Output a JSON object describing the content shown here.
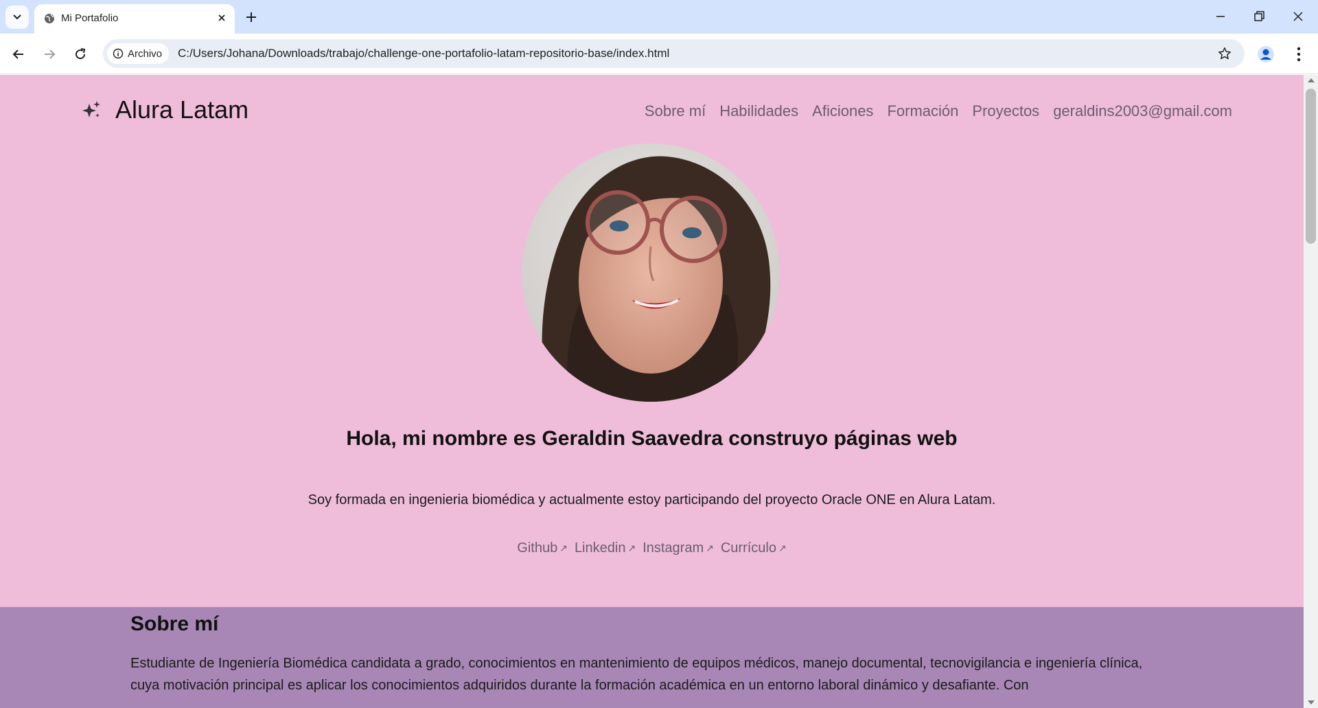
{
  "browser": {
    "tab_title": "Mi Portafolio",
    "site_chip": "Archivo",
    "url": "C:/Users/Johana/Downloads/trabajo/challenge-one-portafolio-latam-repositorio-base/index.html",
    "colors": {
      "tabbar": "#d3e3fd",
      "omnibox": "#e9eef6"
    }
  },
  "header": {
    "brand": "Alura Latam",
    "nav": [
      "Sobre mí",
      "Habilidades",
      "Aficiones",
      "Formación",
      "Proyectos",
      "geraldins2003@gmail.com"
    ]
  },
  "hero": {
    "title": "Hola, mi nombre es Geraldin Saavedra construyo páginas web",
    "text": "Soy formada en ingenieria biomédica y actualmente estoy participando del proyecto Oracle ONE en Alura Latam.",
    "links": [
      "Github",
      "Linkedin",
      "Instagram",
      "Currículo"
    ]
  },
  "about": {
    "title": "Sobre mí",
    "text": "Estudiante de Ingeniería Biomédica candidata a grado, conocimientos en mantenimiento de equipos médicos, manejo documental, tecnovigilancia e ingeniería clínica, cuya motivación principal es aplicar los conocimientos adquiridos durante la formación académica en un entorno laboral dinámico y desafiante. Con"
  },
  "colors": {
    "page_bg": "#efbdda",
    "about_bg": "#a887b6",
    "nav_link": "#6c5b72",
    "text": "#111111"
  }
}
